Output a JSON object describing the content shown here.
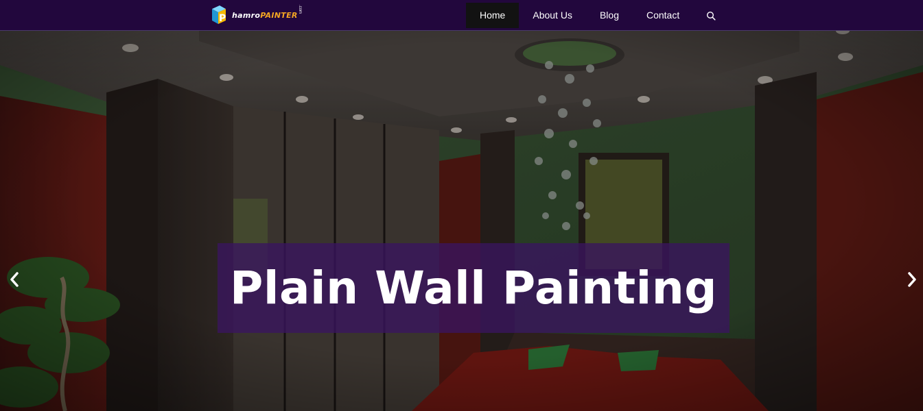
{
  "brand": {
    "prefix": "hamro",
    "name": "PAINTER",
    "suffix": ".com",
    "logo_icon": "hp-cube-logo"
  },
  "nav": {
    "items": [
      {
        "label": "Home",
        "active": true
      },
      {
        "label": "About Us",
        "active": false
      },
      {
        "label": "Blog",
        "active": false
      },
      {
        "label": "Contact",
        "active": false
      }
    ],
    "search_icon": "search-icon"
  },
  "hero": {
    "title": "Plain Wall Painting",
    "prev_icon": "chevron-left-icon",
    "next_icon": "chevron-right-icon"
  },
  "colors": {
    "navbar_bg": "#22073d",
    "active_nav_bg": "#121212",
    "caption_bg": "#3a145f",
    "brand_accent": "#f5a623"
  }
}
